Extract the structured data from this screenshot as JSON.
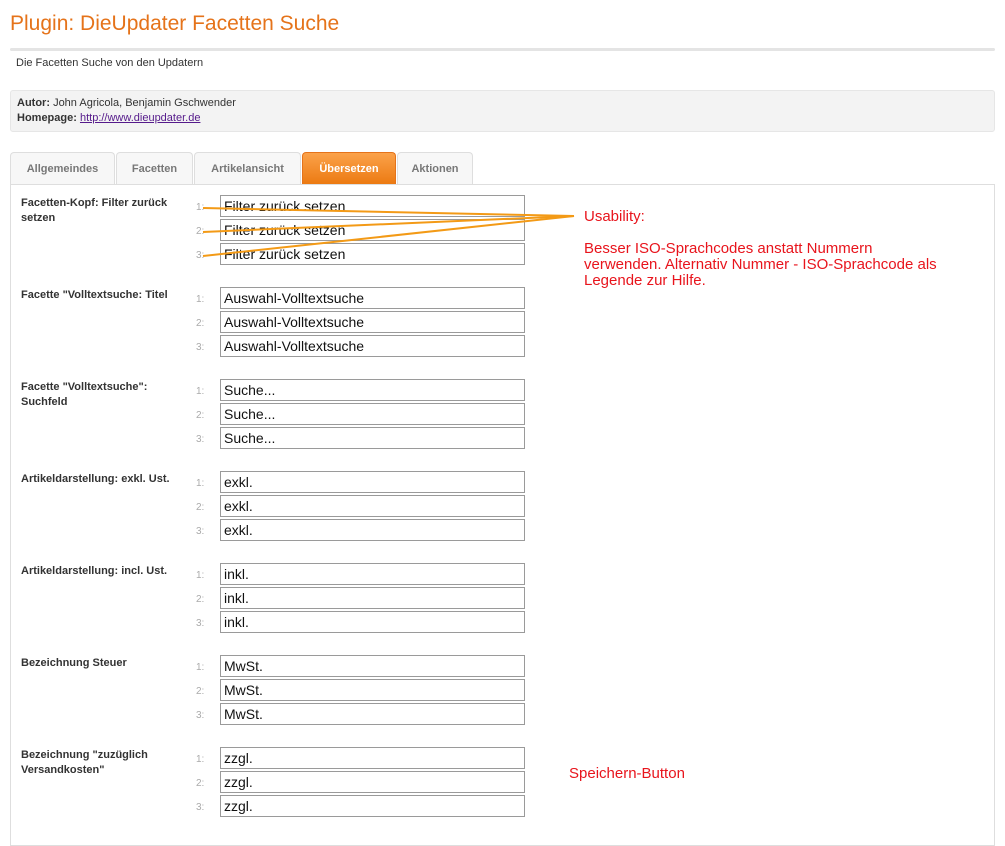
{
  "header": {
    "title": "Plugin: DieUpdater Facetten Suche",
    "description": "Die Facetten Suche von den Updatern"
  },
  "meta": {
    "author_label": "Autor:",
    "author_value": "John Agricola, Benjamin Gschwender",
    "homepage_label": "Homepage:",
    "homepage_link": "http://www.dieupdater.de"
  },
  "tabs": [
    {
      "label": "Allgemeindes"
    },
    {
      "label": "Facetten"
    },
    {
      "label": "Artikelansicht"
    },
    {
      "label": "Übersetzen",
      "active": true
    },
    {
      "label": "Aktionen"
    }
  ],
  "colors": {
    "accent": "#e5731a",
    "tab_active": "#ec7a12",
    "annotation": "#e8141c",
    "arrow": "#f39a16"
  },
  "sections": [
    {
      "label": "Facetten-Kopf: Filter zurück setzen",
      "values": [
        "Filter zurück setzen",
        "Filter zurück setzen",
        "Filter zurück setzen"
      ]
    },
    {
      "label": "Facette \"Volltextsuche: Titel",
      "values": [
        "Auswahl-Volltextsuche",
        "Auswahl-Volltextsuche",
        "Auswahl-Volltextsuche"
      ]
    },
    {
      "label": "Facette \"Volltextsuche\": Suchfeld",
      "values": [
        "Suche...",
        "Suche...",
        "Suche..."
      ]
    },
    {
      "label": "Artikeldarstellung: exkl. Ust.",
      "values": [
        "exkl.",
        "exkl.",
        "exkl."
      ]
    },
    {
      "label": "Artikeldarstellung: incl. Ust.",
      "values": [
        "inkl.",
        "inkl.",
        "inkl."
      ]
    },
    {
      "label": "Bezeichnung Steuer",
      "values": [
        "MwSt.",
        "MwSt.",
        "MwSt."
      ]
    },
    {
      "label": "Bezeichnung \"zuzüglich Versandkosten\"",
      "values": [
        "zzgl.",
        "zzgl.",
        "zzgl."
      ]
    }
  ],
  "line_numbers": [
    "1:",
    "2:",
    "3:"
  ],
  "annotations": {
    "usability_title": "Usability:",
    "usability_line1": "Besser ISO-Sprachcodes anstatt Nummern",
    "usability_line2": "verwenden. Alternativ Nummer - ISO-Sprachcode als",
    "usability_line3": "Legende zur Hilfe.",
    "save_note": "Speichern-Button"
  }
}
